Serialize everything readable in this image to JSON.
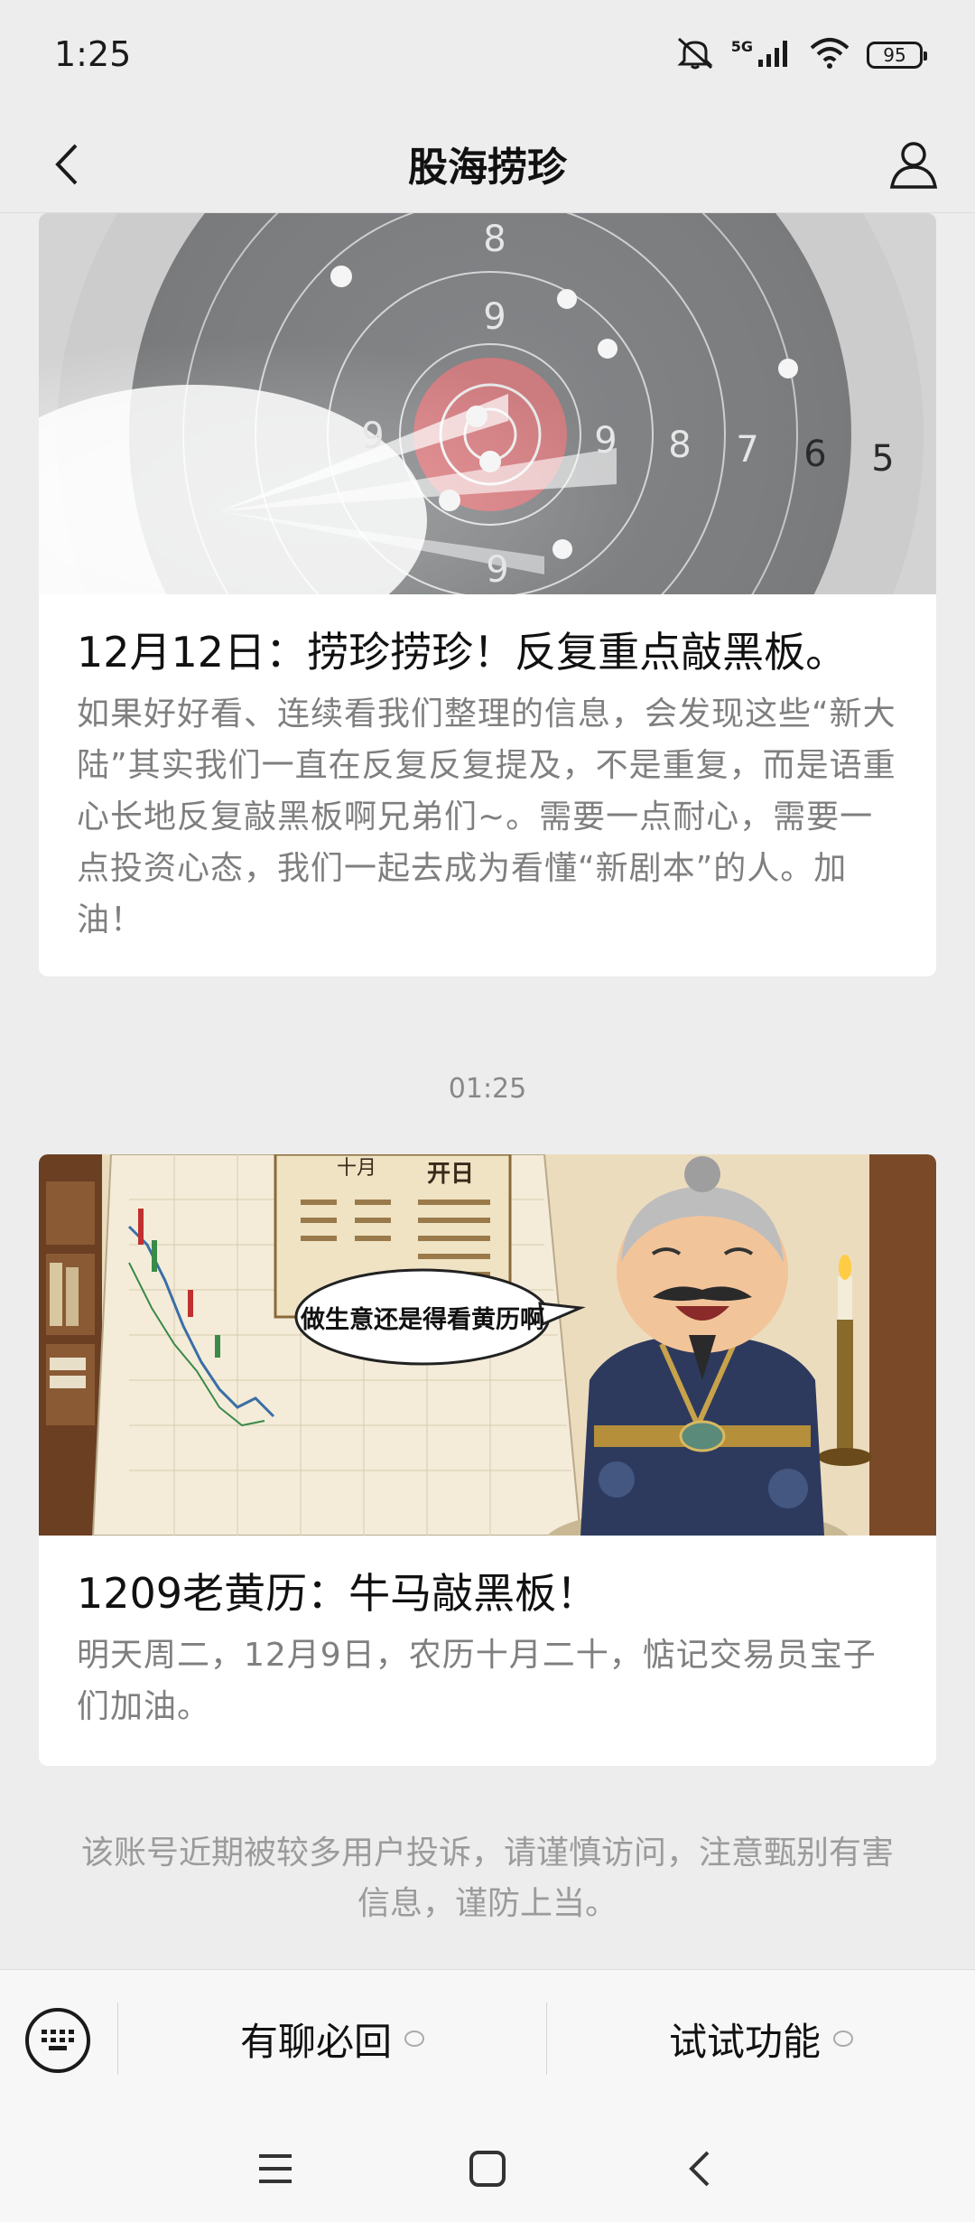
{
  "status": {
    "time": "1:25",
    "network": "5G",
    "battery": "95"
  },
  "header": {
    "title": "股海捞珍"
  },
  "articles": [
    {
      "image": "target-shooting-image",
      "title": "12月12日：捞珍捞珍！反复重点敲黑板。",
      "summary": "如果好好看、连续看我们整理的信息，会发现这些“新大陆”其实我们一直在反复反复提及，不是重复，而是语重心长地反复敲黑板啊兄弟们~。需要一点耐心，需要一点投资心态，我们一起去成为看懂“新剧本”的人。加油！",
      "target_numbers": [
        "8",
        "9",
        "9",
        "9",
        "8",
        "7",
        "6",
        "5",
        "9"
      ]
    },
    {
      "image": "almanac-cartoon-image",
      "title": "1209老黄历：牛马敲黑板！",
      "summary": "明天周二，12月9日，农历十月二十，惦记交易员宝子们加油。",
      "speech_bubble": "做生意还是得看黄历啊",
      "calendar_labels": [
        "十月",
        "开日"
      ]
    }
  ],
  "time_separator": "01:25",
  "warning": "该账号近期被较多用户投诉，请谨慎访问，注意甄别有害信息，谨防上当。",
  "bottom_menu": {
    "item1": "有聊必回",
    "item2": "试试功能"
  }
}
